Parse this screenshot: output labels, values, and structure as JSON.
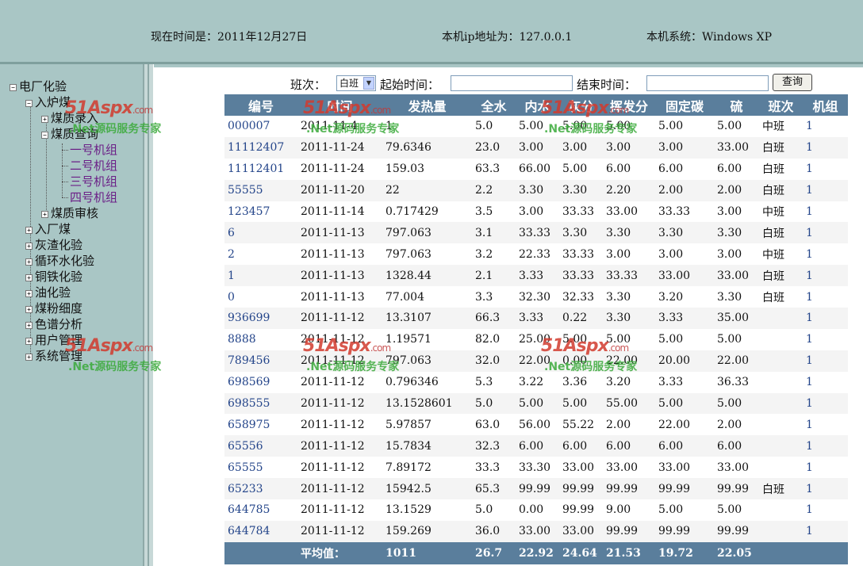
{
  "header": {
    "time_label": "现在时间是：2011年12月27日",
    "ip_label": "本机ip地址为：127.0.0.1",
    "os_label": "本机系统：Windows XP"
  },
  "tree": {
    "root": "电厂化验",
    "furnace": "入炉煤",
    "quality_entry": "煤质录入",
    "quality_query": "煤质查询",
    "units": [
      "一号机组",
      "二号机组",
      "三号机组",
      "四号机组"
    ],
    "quality_review": "煤质审核",
    "others": [
      "入厂煤",
      "灰渣化验",
      "循环水化验",
      "铜铁化验",
      "油化验",
      "煤粉细度",
      "色谱分析",
      "用户管理",
      "系统管理"
    ]
  },
  "watermark": {
    "logo": "51Aspx",
    "domain": ".com",
    "tagline": ".Net源码服务专家"
  },
  "search": {
    "shift_label": "班次：",
    "shift_value": "白班",
    "start_label": "起始时间：",
    "end_label": "结束时间：",
    "query_button": "查询"
  },
  "table": {
    "headers": [
      "编号",
      "时间",
      "发热量",
      "全水",
      "内水",
      "灰分",
      "挥发分",
      "固定碳",
      "硫",
      "班次",
      "机组"
    ],
    "rows": [
      [
        "000007",
        "2011-11-4",
        "1",
        "5.0",
        "5.00",
        "5.00",
        "5.00",
        "5.00",
        "5.00",
        "中班",
        "1"
      ],
      [
        "11112407",
        "2011-11-24",
        "79.6346",
        "23.0",
        "3.00",
        "3.00",
        "3.00",
        "3.00",
        "33.00",
        "白班",
        "1"
      ],
      [
        "11112401",
        "2011-11-24",
        "159.03",
        "63.3",
        "66.00",
        "5.00",
        "6.00",
        "6.00",
        "6.00",
        "白班",
        "1"
      ],
      [
        "55555",
        "2011-11-20",
        "22",
        "2.2",
        "3.30",
        "3.30",
        "2.20",
        "2.00",
        "2.00",
        "白班",
        "1"
      ],
      [
        "123457",
        "2011-11-14",
        "0.717429",
        "3.5",
        "3.00",
        "33.33",
        "33.00",
        "33.33",
        "3.00",
        "中班",
        "1"
      ],
      [
        "6",
        "2011-11-13",
        "797.063",
        "3.1",
        "33.33",
        "3.30",
        "3.30",
        "3.30",
        "3.30",
        "白班",
        "1"
      ],
      [
        "2",
        "2011-11-13",
        "797.063",
        "3.2",
        "22.33",
        "33.33",
        "3.00",
        "3.00",
        "3.00",
        "中班",
        "1"
      ],
      [
        "1",
        "2011-11-13",
        "1328.44",
        "2.1",
        "3.33",
        "33.33",
        "33.33",
        "33.00",
        "33.00",
        "白班",
        "1"
      ],
      [
        "0",
        "2011-11-13",
        "77.004",
        "3.3",
        "32.30",
        "32.33",
        "3.30",
        "3.20",
        "3.30",
        "白班",
        "1"
      ],
      [
        "936699",
        "2011-11-12",
        "13.3107",
        "66.3",
        "3.33",
        "0.22",
        "3.30",
        "3.33",
        "35.00",
        "",
        "1"
      ],
      [
        "8888",
        "2011-11-12",
        "1.19571",
        "82.0",
        "25.00",
        "5.00",
        "5.00",
        "5.00",
        "5.00",
        "",
        "1"
      ],
      [
        "789456",
        "2011-11-12",
        "797.063",
        "32.0",
        "22.00",
        "0.00",
        "22.00",
        "20.00",
        "22.00",
        "",
        "1"
      ],
      [
        "698569",
        "2011-11-12",
        "0.796346",
        "5.3",
        "3.22",
        "3.36",
        "3.20",
        "3.33",
        "36.33",
        "",
        "1"
      ],
      [
        "698555",
        "2011-11-12",
        "13.1528601",
        "5.0",
        "5.00",
        "5.00",
        "55.00",
        "5.00",
        "5.00",
        "",
        "1"
      ],
      [
        "658975",
        "2011-11-12",
        "5.97857",
        "63.0",
        "56.00",
        "55.22",
        "2.00",
        "22.00",
        "2.00",
        "",
        "1"
      ],
      [
        "65556",
        "2011-11-12",
        "15.7834",
        "32.3",
        "6.00",
        "6.00",
        "6.00",
        "6.00",
        "6.00",
        "",
        "1"
      ],
      [
        "65555",
        "2011-11-12",
        "7.89172",
        "33.3",
        "33.30",
        "33.00",
        "33.00",
        "33.00",
        "33.00",
        "",
        "1"
      ],
      [
        "65233",
        "2011-11-12",
        "15942.5",
        "65.3",
        "99.99",
        "99.99",
        "99.99",
        "99.99",
        "99.99",
        "白班",
        "1"
      ],
      [
        "644785",
        "2011-11-12",
        "13.1529",
        "5.0",
        "0.00",
        "99.99",
        "9.00",
        "5.00",
        "5.00",
        "",
        "1"
      ],
      [
        "644784",
        "2011-11-12",
        "159.269",
        "36.0",
        "33.00",
        "33.00",
        "99.99",
        "99.99",
        "99.99",
        "",
        "1"
      ]
    ],
    "footer": [
      "",
      "平均值：",
      "1011",
      "26.7",
      "22.92",
      "24.64",
      "21.53",
      "19.72",
      "22.05",
      "",
      ""
    ]
  }
}
